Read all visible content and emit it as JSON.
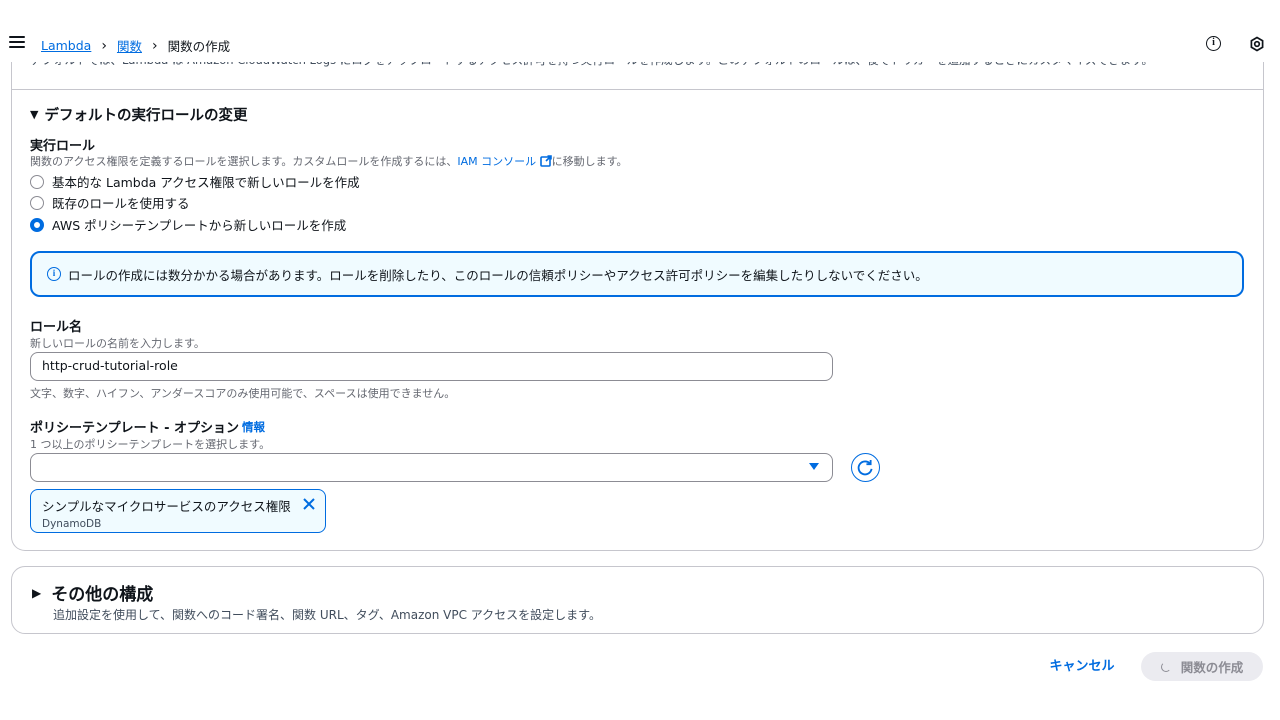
{
  "breadcrumb": {
    "lambda": "Lambda",
    "functions": "関数",
    "current": "関数の作成"
  },
  "clipped_text": "デフォルトでは、Lambda は Amazon CloudWatch Logs にログをアップロードするアクセス許可を持つ実行ロールを作成します。このデフォルトのロールは、後でトリガーを追加するときにカスタマイズできます。",
  "execution_role_section": {
    "toggle_label": "デフォルトの実行ロールの変更",
    "role_label": "実行ロール",
    "role_desc_prefix": "関数のアクセス権限を定義するロールを選択します。カスタムロールを作成するには、",
    "role_desc_link": "IAM コンソール",
    "role_desc_suffix": "に移動します。",
    "options": [
      "基本的な Lambda アクセス権限で新しいロールを作成",
      "既存のロールを使用する",
      "AWS ポリシーテンプレートから新しいロールを作成"
    ],
    "selected_index": 2
  },
  "alert": {
    "text": "ロールの作成には数分かかる場合があります。ロールを削除したり、このロールの信頼ポリシーやアクセス許可ポリシーを編集したりしないでください。"
  },
  "role_name": {
    "label": "ロール名",
    "desc": "新しいロールの名前を入力します。",
    "value": "http-crud-tutorial-role",
    "hint": "文字、数字、ハイフン、アンダースコアのみ使用可能で、スペースは使用できません。"
  },
  "policy_templates": {
    "label": "ポリシーテンプレート - オプション",
    "info": "情報",
    "desc": "1 つ以上のポリシーテンプレートを選択します。",
    "selected_tokens": [
      {
        "label": "シンプルなマイクロサービスのアクセス権限",
        "sub": "DynamoDB"
      }
    ]
  },
  "other_config": {
    "title": "その他の構成",
    "desc": "追加設定を使用して、関数へのコード署名、関数 URL、タグ、Amazon VPC アクセスを設定します。"
  },
  "footer": {
    "cancel": "キャンセル",
    "create": "関数の作成"
  },
  "colors": {
    "accent": "#006ce0",
    "alert_bg": "#f0fbff",
    "border": "#c6c6cd"
  }
}
